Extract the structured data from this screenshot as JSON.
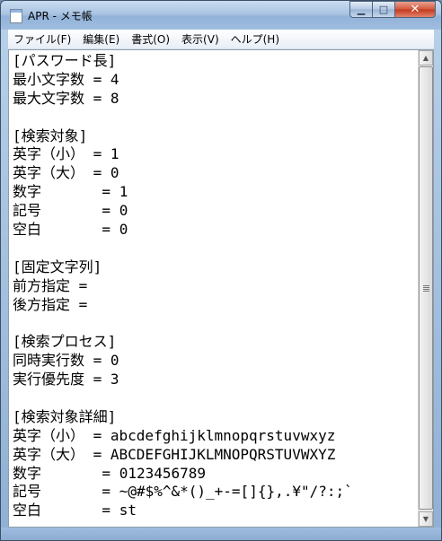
{
  "window": {
    "title": "APR - メモ帳",
    "minimize_glyph": "▁",
    "maximize_glyph": "□",
    "close_glyph": "✕"
  },
  "menu": {
    "items": [
      "ファイル(F)",
      "編集(E)",
      "書式(O)",
      "表示(V)",
      "ヘルプ(H)"
    ]
  },
  "editor": {
    "lines": [
      "[パスワード長]",
      "最小文字数 = 4",
      "最大文字数 = 8",
      "",
      "[検索対象]",
      "英字（小） = 1",
      "英字（大） = 0",
      "数字       = 1",
      "記号       = 0",
      "空白       = 0",
      "",
      "[固定文字列]",
      "前方指定 =",
      "後方指定 =",
      "",
      "[検索プロセス]",
      "同時実行数 = 0",
      "実行優先度 = 3",
      "",
      "[検索対象詳細]",
      "英字（小） = abcdefghijklmnopqrstuvwxyz",
      "英字（大） = ABCDEFGHIJKLMNOPQRSTUVWXYZ",
      "数字       = 0123456789",
      "記号       = ~@#$%^&*()_+-=[]{},.¥\"/?:;`",
      "空白       = st"
    ]
  },
  "scrollbar": {
    "up_glyph": "▲",
    "down_glyph": "▼"
  }
}
